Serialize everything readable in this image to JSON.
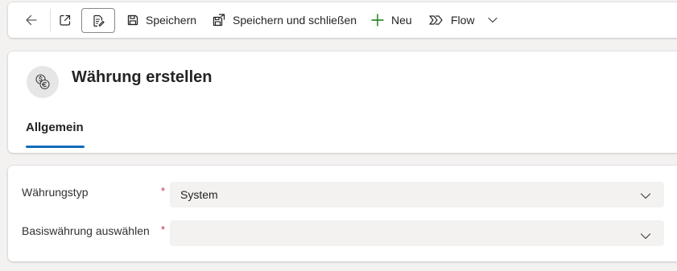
{
  "toolbar": {
    "back_icon": "arrow-left-icon",
    "open_icon": "open-external-icon",
    "edit_icon": "form-edit-icon",
    "save_label": "Speichern",
    "save_close_label": "Speichern und schließen",
    "new_label": "Neu",
    "flow_label": "Flow"
  },
  "header": {
    "entity_icon": "currency-icon",
    "title": "Währung erstellen",
    "tabs": [
      {
        "label": "Allgemein",
        "selected": true
      }
    ]
  },
  "form": {
    "fields": [
      {
        "label": "Währungstyp",
        "required": "*",
        "value": "System"
      },
      {
        "label": "Basiswährung auswählen",
        "required": "*",
        "value": ""
      }
    ]
  },
  "colors": {
    "accent": "#0f6cbd",
    "required": "#c4314b",
    "page_background": "#f3f2f1",
    "new_icon": "#107c10"
  }
}
